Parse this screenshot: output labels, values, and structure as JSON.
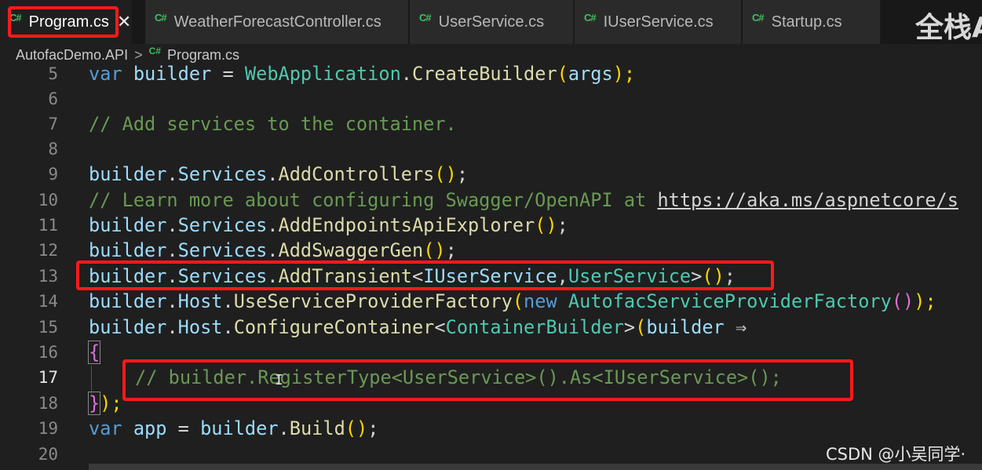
{
  "tabs": [
    {
      "icon": "C#",
      "label": "Program.cs",
      "active": true,
      "close": "✕"
    },
    {
      "icon": "C#",
      "label": "WeatherForecastController.cs"
    },
    {
      "icon": "C#",
      "label": "UserService.cs"
    },
    {
      "icon": "C#",
      "label": "IUserService.cs"
    },
    {
      "icon": "C#",
      "label": "Startup.cs"
    }
  ],
  "watermark_top": "全栈A",
  "breadcrumb": {
    "project": "AutofacDemo.API",
    "separator": ">",
    "icon": "C#",
    "file": "Program.cs"
  },
  "lines": [
    {
      "n": "5"
    },
    {
      "n": "6"
    },
    {
      "n": "7"
    },
    {
      "n": "8"
    },
    {
      "n": "9"
    },
    {
      "n": "10"
    },
    {
      "n": "11"
    },
    {
      "n": "12"
    },
    {
      "n": "13"
    },
    {
      "n": "14"
    },
    {
      "n": "15"
    },
    {
      "n": "16"
    },
    {
      "n": "17"
    },
    {
      "n": "18"
    },
    {
      "n": "19"
    },
    {
      "n": "20"
    }
  ],
  "code": {
    "l5": [
      "var",
      "builder",
      " = ",
      "WebApplication",
      ".",
      "CreateBuilder",
      "(",
      "args",
      ");"
    ],
    "l7": "// Add services to the container.",
    "l9": [
      "builder",
      ".",
      "Services",
      ".",
      "AddControllers",
      "()",
      ";"
    ],
    "l10_comment": "// Learn more about configuring Swagger/OpenAPI at ",
    "l10_link": "https://aka.ms/aspnetcore/s",
    "l11": [
      "builder",
      ".",
      "Services",
      ".",
      "AddEndpointsApiExplorer",
      "()",
      ";"
    ],
    "l12": [
      "builder",
      ".",
      "Services",
      ".",
      "AddSwaggerGen",
      "()",
      ";"
    ],
    "l13": [
      "builder",
      ".",
      "Services",
      ".",
      "AddTransient",
      "<",
      "IUserService",
      ",",
      "UserService",
      ">",
      "()",
      ";"
    ],
    "l14": [
      "builder",
      ".",
      "Host",
      ".",
      "UseServiceProviderFactory",
      "(",
      "new",
      "AutofacServiceProviderFactory",
      "()",
      ");"
    ],
    "l15": [
      "builder",
      ".",
      "Host",
      ".",
      "ConfigureContainer",
      "<",
      "ContainerBuilder",
      ">",
      "(",
      "builder",
      " ⇒"
    ],
    "l16": "{",
    "l17": "// builder.RegisterType<UserService>().As<IUserService>();",
    "l18": [
      "}",
      ");"
    ],
    "l19": [
      "var",
      "app",
      " = ",
      "builder",
      ".",
      "Build",
      "()",
      ";"
    ]
  },
  "watermark_bottom": "CSDN @小吴同学·"
}
